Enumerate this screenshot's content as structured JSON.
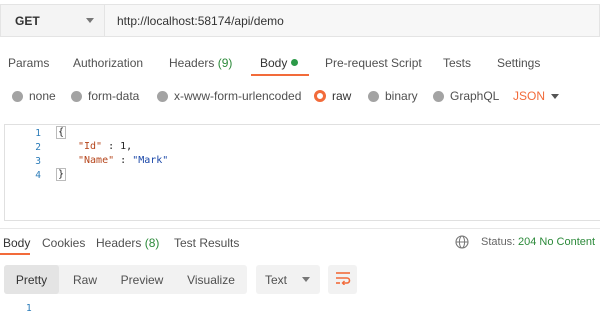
{
  "request": {
    "method": "GET",
    "url": "http://localhost:58174/api/demo"
  },
  "request_tabs": {
    "params": "Params",
    "authorization": "Authorization",
    "headers": "Headers",
    "headers_count": "(9)",
    "body": "Body",
    "prerequest": "Pre-request Script",
    "tests": "Tests",
    "settings": "Settings"
  },
  "body_types": {
    "none": "none",
    "form_data": "form-data",
    "urlencoded": "x-www-form-urlencoded",
    "raw": "raw",
    "binary": "binary",
    "graphql": "GraphQL",
    "selected_format": "JSON"
  },
  "editor": {
    "line_numbers": [
      "1",
      "2",
      "3",
      "4"
    ],
    "line1": "{",
    "line2_key": "\"Id\"",
    "line2_rest": " : 1,",
    "line3_key": "\"Name\"",
    "line3_sep": " : ",
    "line3_val": "\"Mark\"",
    "line4": "}"
  },
  "response_tabs": {
    "body": "Body",
    "cookies": "Cookies",
    "headers": "Headers",
    "headers_count": "(8)",
    "test_results": "Test Results"
  },
  "status": {
    "label": "Status:",
    "value": "204 No Content"
  },
  "view": {
    "pretty": "Pretty",
    "raw": "Raw",
    "preview": "Preview",
    "visualize": "Visualize",
    "text_format": "Text"
  },
  "response_editor": {
    "line_number": "1"
  },
  "colors": {
    "accent": "#f26b3a",
    "success": "#2c8a3a",
    "line_number": "#2a7bb8"
  }
}
